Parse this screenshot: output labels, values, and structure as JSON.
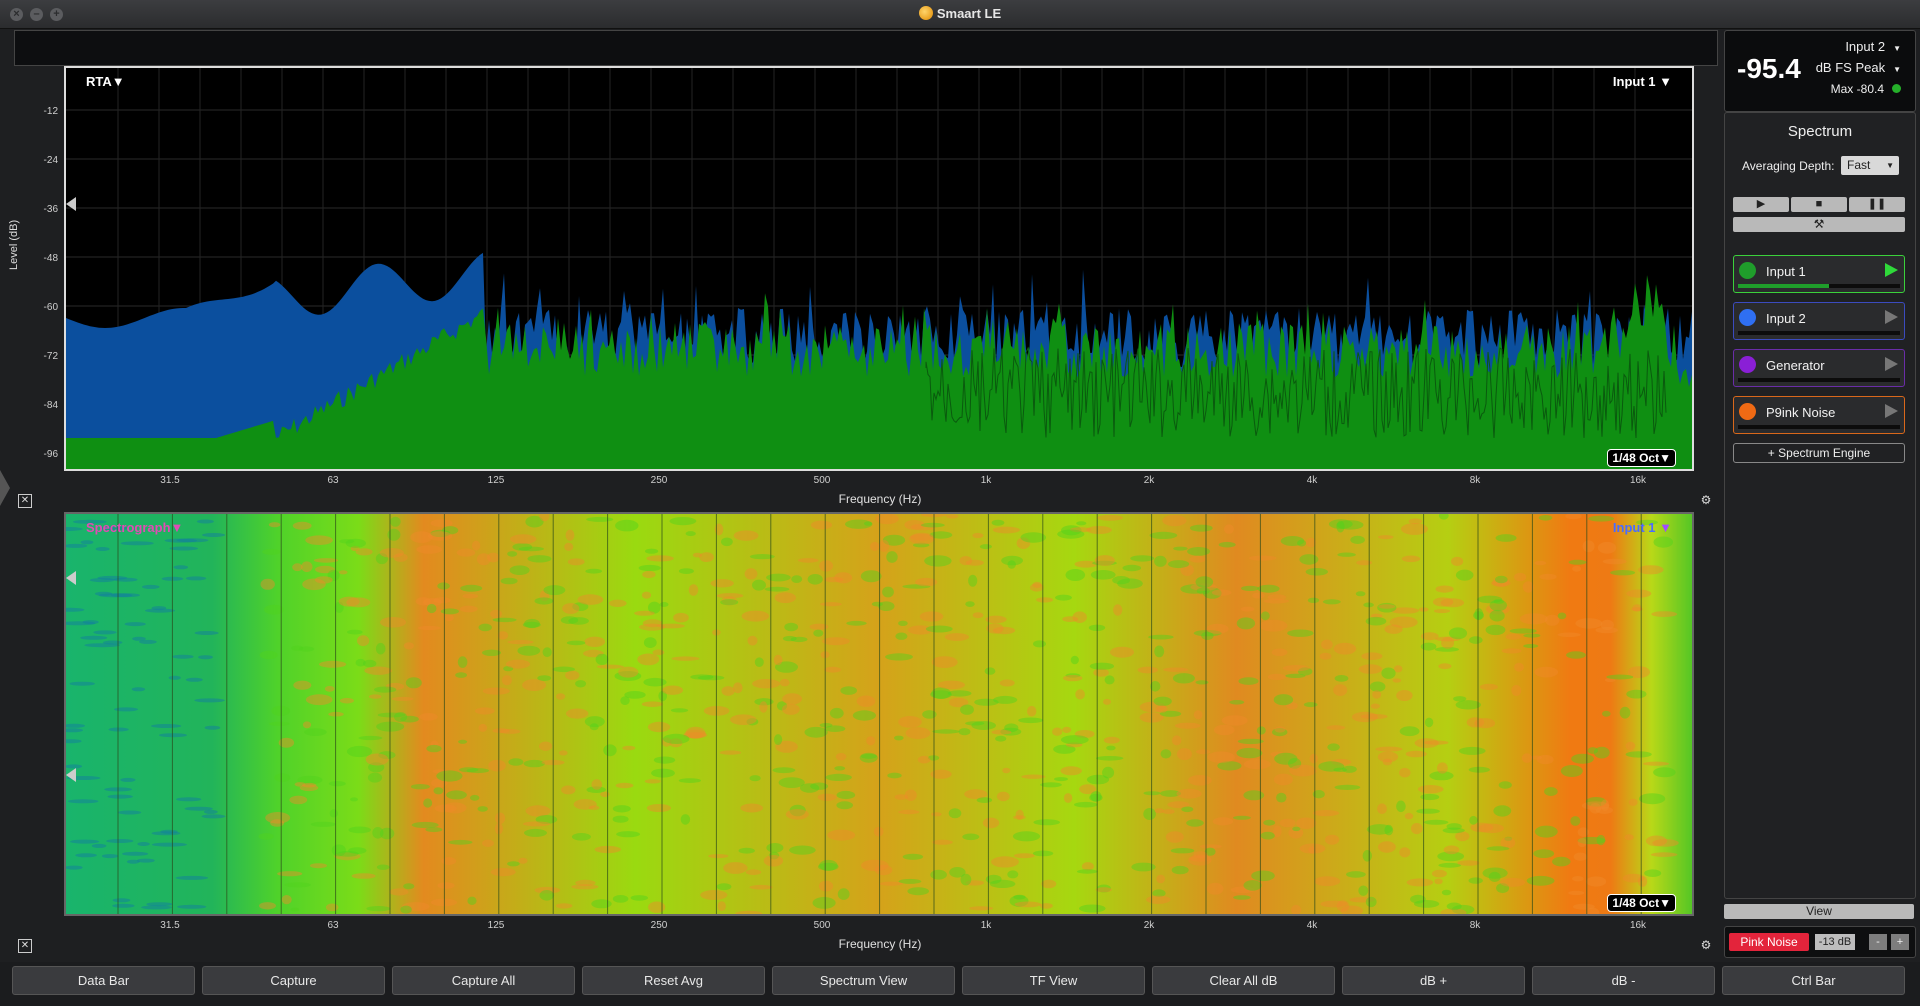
{
  "window": {
    "title": "Smaart LE"
  },
  "rta": {
    "mode_label": "RTA",
    "input_label": "Input 1",
    "octave": "1/48 Oct",
    "ylabel": "Level (dB)",
    "yticks": [
      "-12",
      "-24",
      "-36",
      "-48",
      "-60",
      "-72",
      "-84",
      "-96"
    ],
    "xticks": [
      "31.5",
      "63",
      "125",
      "250",
      "500",
      "1k",
      "2k",
      "4k",
      "8k",
      "16k"
    ],
    "xlabel": "Frequency (Hz)"
  },
  "spectrograph": {
    "mode_label": "Spectrograph",
    "input_label": "Input 1",
    "octave": "1/48 Oct",
    "xticks": [
      "31.5",
      "63",
      "125",
      "250",
      "500",
      "1k",
      "2k",
      "4k",
      "8k",
      "16k"
    ],
    "xlabel": "Frequency (Hz)"
  },
  "meter": {
    "value": "-95.4",
    "channel": "Input 2",
    "unit": "dB FS Peak",
    "max": "Max -80.4"
  },
  "spectrum_panel": {
    "title": "Spectrum",
    "averaging_label": "Averaging Depth:",
    "averaging_value": "Fast",
    "channels": [
      {
        "name": "Input 1",
        "color": "#1f9d2b",
        "border": "#3bd13b",
        "level": 0.56
      },
      {
        "name": "Input 2",
        "color": "#2f6ff2",
        "border": "#3b4bbf",
        "level": 0
      },
      {
        "name": "Generator",
        "color": "#8a1fd6",
        "border": "#6a2da8",
        "level": 0
      },
      {
        "name": "P9ink Noise",
        "color": "#f06a14",
        "border": "#d9681b",
        "level": 0
      }
    ],
    "add_engine": "+ Spectrum Engine"
  },
  "view": {
    "label": "View"
  },
  "generator": {
    "button": "Pink Noise",
    "level": "-13 dB",
    "minus": "-",
    "plus": "+"
  },
  "bottom_bar": [
    "Data Bar",
    "Capture",
    "Capture All",
    "Reset Avg",
    "Spectrum View",
    "TF View",
    "Clear All dB",
    "dB +",
    "dB -",
    "Ctrl Bar"
  ]
}
